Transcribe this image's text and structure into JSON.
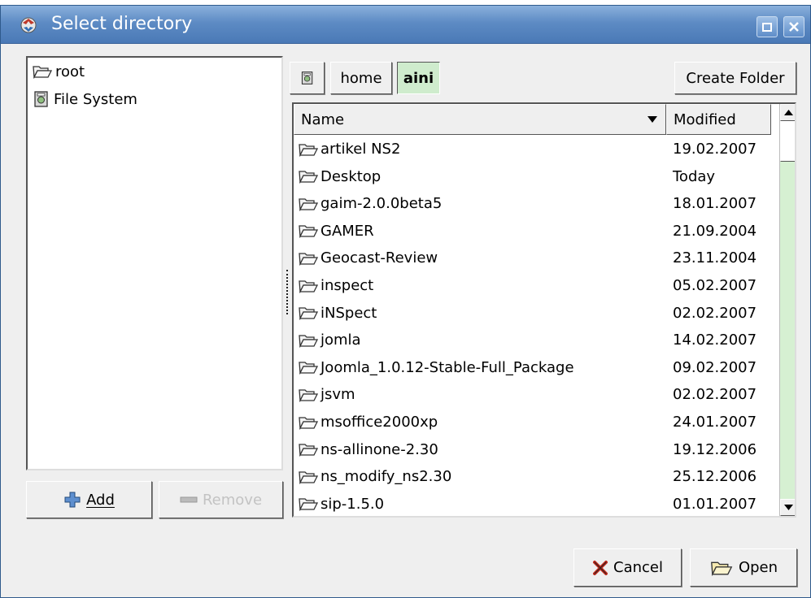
{
  "window": {
    "title": "Select directory"
  },
  "places": {
    "items": [
      {
        "label": "root",
        "icon": "folder-icon"
      },
      {
        "label": "File System",
        "icon": "drive-icon"
      }
    ],
    "add_label": "Add",
    "remove_label": "Remove"
  },
  "pathbar": {
    "segments": [
      "home",
      "aini"
    ],
    "create_folder_label": "Create Folder"
  },
  "list": {
    "columns": [
      "Name",
      "Modified"
    ],
    "rows": [
      {
        "name": "artikel NS2",
        "modified": "19.02.2007"
      },
      {
        "name": "Desktop",
        "modified": "Today"
      },
      {
        "name": "gaim-2.0.0beta5",
        "modified": "18.01.2007"
      },
      {
        "name": "GAMER",
        "modified": "21.09.2004"
      },
      {
        "name": "Geocast-Review",
        "modified": "23.11.2004"
      },
      {
        "name": "inspect",
        "modified": "05.02.2007"
      },
      {
        "name": "iNSpect",
        "modified": "02.02.2007"
      },
      {
        "name": "jomla",
        "modified": "14.02.2007"
      },
      {
        "name": "Joomla_1.0.12-Stable-Full_Package",
        "modified": "09.02.2007"
      },
      {
        "name": "jsvm",
        "modified": "02.02.2007"
      },
      {
        "name": "msoffice2000xp",
        "modified": "24.01.2007"
      },
      {
        "name": "ns-allinone-2.30",
        "modified": "19.12.2006"
      },
      {
        "name": "ns_modify_ns2.30",
        "modified": "25.12.2006"
      },
      {
        "name": "sip-1.5.0",
        "modified": "01.01.2007"
      }
    ]
  },
  "actions": {
    "cancel_label": "Cancel",
    "open_label": "Open"
  },
  "colors": {
    "titlebar": "#5d8bc4",
    "selected_segment": "#cfeccd",
    "scroll_trough": "#d6f0d2"
  }
}
